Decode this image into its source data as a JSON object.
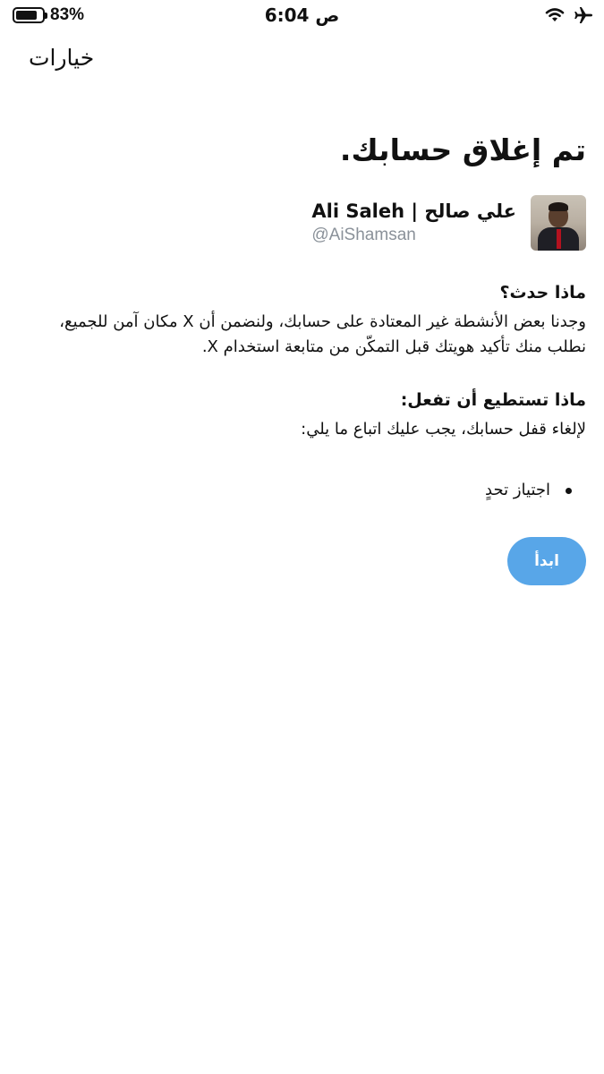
{
  "status_bar": {
    "battery_percent": "83%",
    "battery_level": 0.83,
    "time": "6:04 ص",
    "icons": [
      "wifi-icon",
      "airplane-icon"
    ]
  },
  "header": {
    "title": "خيارات"
  },
  "main": {
    "title": "تم إغلاق حسابك.",
    "profile": {
      "display_name": "علي صالح | Ali Saleh",
      "handle": "@AiShamsan"
    },
    "what_happened": {
      "heading": "ماذا حدث؟",
      "body": "وجدنا بعض الأنشطة غير المعتادة على حسابك، ولنضمن أن X مكان آمن للجميع، نطلب منك تأكيد هويتك قبل التمكّن من متابعة استخدام X."
    },
    "what_to_do": {
      "heading": "ماذا تستطيع أن تفعل:",
      "body": "لإلغاء قفل حسابك، يجب عليك اتباع ما يلي:",
      "steps": [
        "اجتياز تحدٍ"
      ]
    },
    "start_button": "ابدأ"
  },
  "colors": {
    "button_bg": "#58a6e8",
    "handle_text": "#8a9199"
  }
}
